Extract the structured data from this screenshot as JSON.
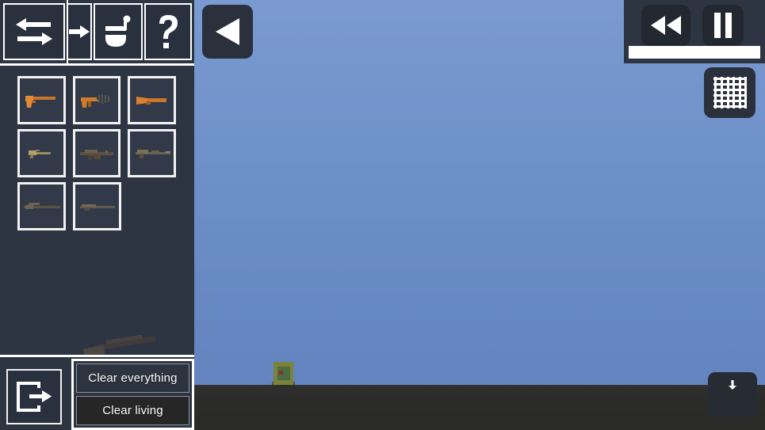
{
  "app": {
    "title": "Sandbox Weapon Spawner",
    "sky_color": "#6e90c8",
    "ground_color": "#2b2b2a",
    "panel_color": "#2d3442",
    "accent_color": "#ffffff"
  },
  "toolbar": {
    "buttons": [
      {
        "name": "swap-tool",
        "icon": "swap-arrows-icon",
        "label": "Swap"
      },
      {
        "name": "next-tool",
        "icon": "arrow-right-icon",
        "label": "Next"
      },
      {
        "name": "paint-tool",
        "icon": "paint-bucket-icon",
        "label": "Paint"
      },
      {
        "name": "help-tool",
        "icon": "question-mark-icon",
        "label": "Help"
      }
    ]
  },
  "weapon_grid": {
    "rows": [
      [
        {
          "name": "weapon-pistol",
          "label": "Pistol",
          "selected": true
        },
        {
          "name": "weapon-smg",
          "label": "SMG",
          "selected": false
        },
        {
          "name": "weapon-sawed-off",
          "label": "Sawed-off Shotgun",
          "selected": false
        }
      ],
      [
        {
          "name": "weapon-compact-smg",
          "label": "Compact SMG",
          "selected": false
        },
        {
          "name": "weapon-assault-rifle",
          "label": "Assault Rifle",
          "selected": false
        },
        {
          "name": "weapon-carbine",
          "label": "Carbine",
          "selected": false
        }
      ],
      [
        {
          "name": "weapon-sniper-rifle",
          "label": "Sniper Rifle",
          "selected": false
        },
        {
          "name": "weapon-marksman-rifle",
          "label": "Marksman Rifle",
          "selected": false
        }
      ]
    ]
  },
  "bottom_left": {
    "exit_icon": "exit-door-icon",
    "exit_label": "Exit",
    "clear_everything_label": "Clear everything",
    "clear_living_label": "Clear living"
  },
  "overlay": {
    "back_icon": "back-triangle-icon",
    "back_label": "Back",
    "grid_icon": "grid-toggle-icon",
    "grid_label": "Toggle grid",
    "download_icon": "download-icon",
    "download_label": "Download"
  },
  "playback": {
    "rewind_icon": "rewind-double-triangle-icon",
    "rewind_label": "Rewind",
    "pause_icon": "pause-bars-icon",
    "pause_label": "Pause",
    "progress_percent": 100,
    "progress_value": "100%"
  },
  "world": {
    "entity_name": "creature-entity",
    "entity_label": "Creature",
    "weapon_preview_label": "Selected weapon preview"
  }
}
